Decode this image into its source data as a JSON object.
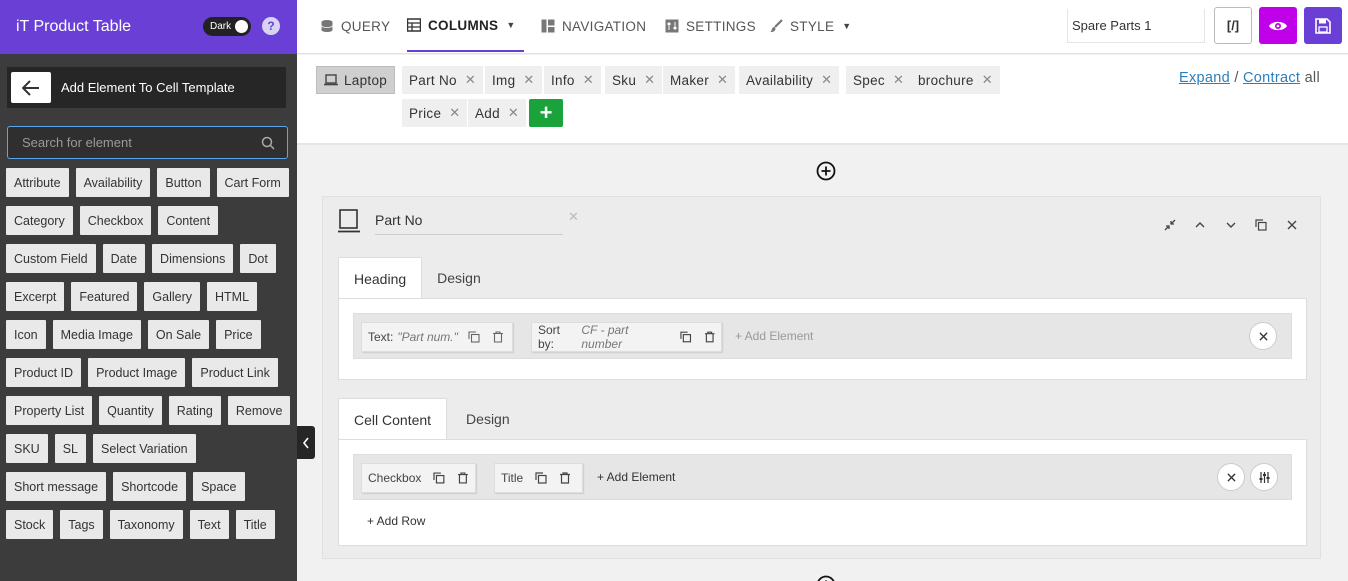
{
  "sidebar": {
    "title": "iT Product Table",
    "dark_label": "Dark",
    "help": "?",
    "add_element_title": "Add Element To Cell Template",
    "search_placeholder": "Search for element",
    "elements": [
      "Attribute",
      "Availability",
      "Button",
      "Cart Form",
      "Category",
      "Checkbox",
      "Content",
      "Custom Field",
      "Date",
      "Dimensions",
      "Dot",
      "Excerpt",
      "Featured",
      "Gallery",
      "HTML",
      "Icon",
      "Media Image",
      "On Sale",
      "Price",
      "Product ID",
      "Product Image",
      "Product Link",
      "Property List",
      "Quantity",
      "Rating",
      "Remove",
      "SKU",
      "SL",
      "Select Variation",
      "Short message",
      "Shortcode",
      "Space",
      "Stock",
      "Tags",
      "Taxonomy",
      "Text",
      "Title"
    ]
  },
  "nav": {
    "query": "QUERY",
    "columns": "COLUMNS",
    "navigation": "NAVIGATION",
    "settings": "SETTINGS",
    "style": "STYLE",
    "preset_name": "Spare Parts 1",
    "code_label": "[/]",
    "accent": "#6a3fd6",
    "preview_color": "#c000e8"
  },
  "columns": {
    "device": "Laptop",
    "row1": [
      "Part No",
      "Img",
      "Info",
      "Sku",
      "Maker",
      "Availability",
      "Spec",
      "brochure"
    ],
    "row2": [
      "Price",
      "Add"
    ],
    "add_symbol": "+",
    "expand": "Expand",
    "separator": "/",
    "contract": "Contract",
    "all": "all"
  },
  "card": {
    "column_name": "Part No",
    "heading": {
      "tabs": [
        "Heading",
        "Design"
      ],
      "text_label": "Text:",
      "text_value": "\"Part num.\"",
      "sort_label": "Sort by:",
      "sort_value": "CF - part number",
      "add_element": "+ Add Element"
    },
    "cell": {
      "tabs": [
        "Cell Content",
        "Design"
      ],
      "items": [
        "Checkbox",
        "Title"
      ],
      "add_element": "+ Add Element",
      "add_row": "+ Add Row"
    }
  }
}
